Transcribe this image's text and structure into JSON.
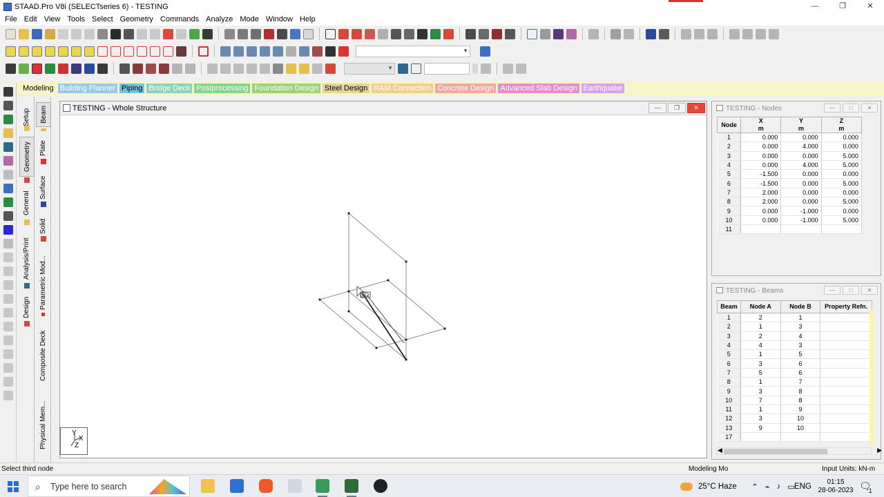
{
  "window": {
    "title": "STAAD.Pro V8i (SELECTseries 6) - TESTING",
    "min": "—",
    "max": "❐",
    "close": "✕"
  },
  "menu": [
    "File",
    "Edit",
    "View",
    "Tools",
    "Select",
    "Geometry",
    "Commands",
    "Analyze",
    "Mode",
    "Window",
    "Help"
  ],
  "ribbon": [
    {
      "label": "Modeling",
      "color": "#000000",
      "bg": "transparent"
    },
    {
      "label": "Building Planner",
      "color": "#ffffff",
      "bg": "#9ac8e8"
    },
    {
      "label": "Piping",
      "color": "#000000",
      "bg": "#76c2e3"
    },
    {
      "label": "Bridge Deck",
      "color": "#ffffff",
      "bg": "#8fd0bd"
    },
    {
      "label": "Postprocessing",
      "color": "#ffffff",
      "bg": "#86d48a"
    },
    {
      "label": "Foundation Design",
      "color": "#ffffff",
      "bg": "#9bd27a"
    },
    {
      "label": "Steel Design",
      "color": "#000000",
      "bg": "#e8d49a"
    },
    {
      "label": "RAM Connection",
      "color": "#ffffff",
      "bg": "#f2cf8f"
    },
    {
      "label": "Concrete Design",
      "color": "#ffffff",
      "bg": "#f0a8a0"
    },
    {
      "label": "Advanced Slab Design",
      "color": "#ffffff",
      "bg": "#e28ec8"
    },
    {
      "label": "Earthquake",
      "color": "#ffffff",
      "bg": "#d8a2ea"
    }
  ],
  "page_tabs_outer": [
    "Setup",
    "Geometry",
    "General",
    "Analysis/Print",
    "Design"
  ],
  "page_tabs_inner": [
    "Beam",
    "Plate",
    "Surface",
    "Solid",
    "Parametric Mod...",
    "Composite Deck",
    "Physical Mem..."
  ],
  "view": {
    "title": "TESTING - Whole Structure",
    "axis_y": "Y",
    "axis_x": "X",
    "axis_z": "Z"
  },
  "nodes_panel": {
    "title": "TESTING - Nodes",
    "headers": [
      {
        "name": "Node",
        "unit": ""
      },
      {
        "name": "X",
        "unit": "m"
      },
      {
        "name": "Y",
        "unit": "m"
      },
      {
        "name": "Z",
        "unit": "m"
      }
    ],
    "rows": [
      [
        "1",
        "0.000",
        "0.000",
        "0.000"
      ],
      [
        "2",
        "0.000",
        "4.000",
        "0.000"
      ],
      [
        "3",
        "0.000",
        "0.000",
        "5.000"
      ],
      [
        "4",
        "0.000",
        "4.000",
        "5.000"
      ],
      [
        "5",
        "-1.500",
        "0.000",
        "0.000"
      ],
      [
        "6",
        "-1.500",
        "0.000",
        "5.000"
      ],
      [
        "7",
        "2.000",
        "0.000",
        "0.000"
      ],
      [
        "8",
        "2.000",
        "0.000",
        "5.000"
      ],
      [
        "9",
        "0.000",
        "-1.000",
        "0.000"
      ],
      [
        "10",
        "0.000",
        "-1.000",
        "5.000"
      ],
      [
        "11",
        "",
        "",
        ""
      ]
    ]
  },
  "beams_panel": {
    "title": "TESTING - Beams",
    "headers": [
      "Beam",
      "Node A",
      "Node B",
      "Property Refn."
    ],
    "rows": [
      [
        "1",
        "2",
        "1",
        ""
      ],
      [
        "2",
        "1",
        "3",
        ""
      ],
      [
        "3",
        "2",
        "4",
        ""
      ],
      [
        "4",
        "4",
        "3",
        ""
      ],
      [
        "5",
        "1",
        "5",
        ""
      ],
      [
        "6",
        "3",
        "6",
        ""
      ],
      [
        "7",
        "5",
        "6",
        ""
      ],
      [
        "8",
        "1",
        "7",
        ""
      ],
      [
        "9",
        "3",
        "8",
        ""
      ],
      [
        "10",
        "7",
        "8",
        ""
      ],
      [
        "11",
        "1",
        "9",
        ""
      ],
      [
        "12",
        "3",
        "10",
        ""
      ],
      [
        "13",
        "9",
        "10",
        ""
      ],
      [
        "17",
        "",
        "",
        ""
      ]
    ]
  },
  "status": {
    "hint": "Select third node",
    "mode": "Modeling Mo",
    "units": "Input Units:  kN-m"
  },
  "taskbar": {
    "search_placeholder": "Type here to search",
    "weather": "25°C  Haze",
    "lang": "ENG",
    "time": "01:15",
    "date": "28-06-2023",
    "notif": "1"
  }
}
